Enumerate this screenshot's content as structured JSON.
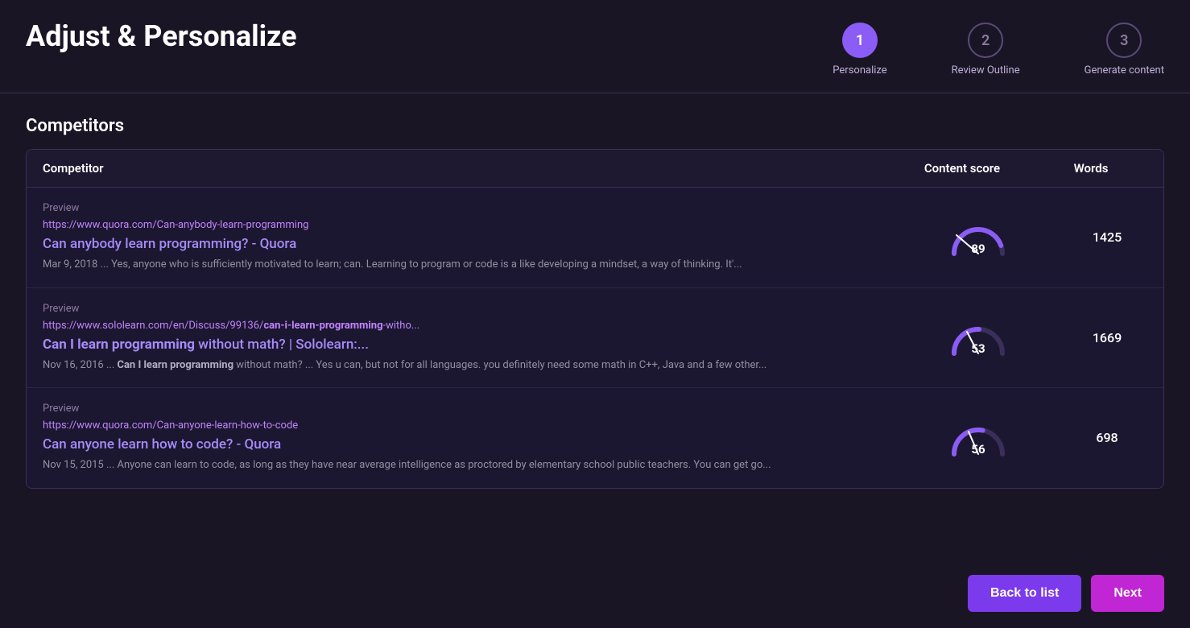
{
  "page": {
    "title": "Adjust & Personalize"
  },
  "steps": [
    {
      "number": "1",
      "label": "Personalize",
      "active": true
    },
    {
      "number": "2",
      "label": "Review Outline",
      "active": false
    },
    {
      "number": "3",
      "label": "Generate content",
      "active": false
    }
  ],
  "section": {
    "title": "Competitors"
  },
  "table": {
    "headers": {
      "competitor": "Competitor",
      "content_score": "Content score",
      "words": "Words"
    },
    "rows": [
      {
        "preview_label": "Preview",
        "url": "https://www.quora.com/Can-anybody-learn-programming",
        "url_display": "https://www.quora.com/Can-anybody-learn-programming",
        "title_plain": "Can anybody learn programming? - Quora",
        "title_bold_parts": [],
        "snippet": "Mar 9, 2018 ... Yes, anyone who is sufficiently motivated to learn; can. Learning to program or code is a like developing a mindset, a way of thinking. It'...",
        "score": 89,
        "words": "1425",
        "gauge_color": "#8b5cf6"
      },
      {
        "preview_label": "Preview",
        "url": "https://www.sololearn.com/en/Discuss/99136/can-i-learn-programming-witho...",
        "url_display": "https://www.sololearn.com/en/Discuss/99136/can-i-learn-programming-witho...",
        "title_plain": "Can I learn programming without math? | Sololearn:...",
        "title_bold_parts": [
          "Can I learn programming"
        ],
        "snippet": "Nov 16, 2016 ... Can I learn programming without math? ... Yes u can, but not for all languages. you definitely need some math in C++, Java and a few other...",
        "score": 53,
        "words": "1669",
        "gauge_color": "#8b5cf6"
      },
      {
        "preview_label": "Preview",
        "url": "https://www.quora.com/Can-anyone-learn-how-to-code",
        "url_display": "https://www.quora.com/Can-anyone-learn-how-to-code",
        "title_plain": "Can anyone learn how to code? - Quora",
        "title_bold_parts": [],
        "snippet": "Nov 15, 2015 ... Anyone can learn to code, as long as they have near average intelligence as proctored by elementary school public teachers. You can get go...",
        "score": 56,
        "words": "698",
        "gauge_color": "#8b5cf6"
      }
    ]
  },
  "footer": {
    "back_label": "Back to list",
    "next_label": "Next"
  }
}
